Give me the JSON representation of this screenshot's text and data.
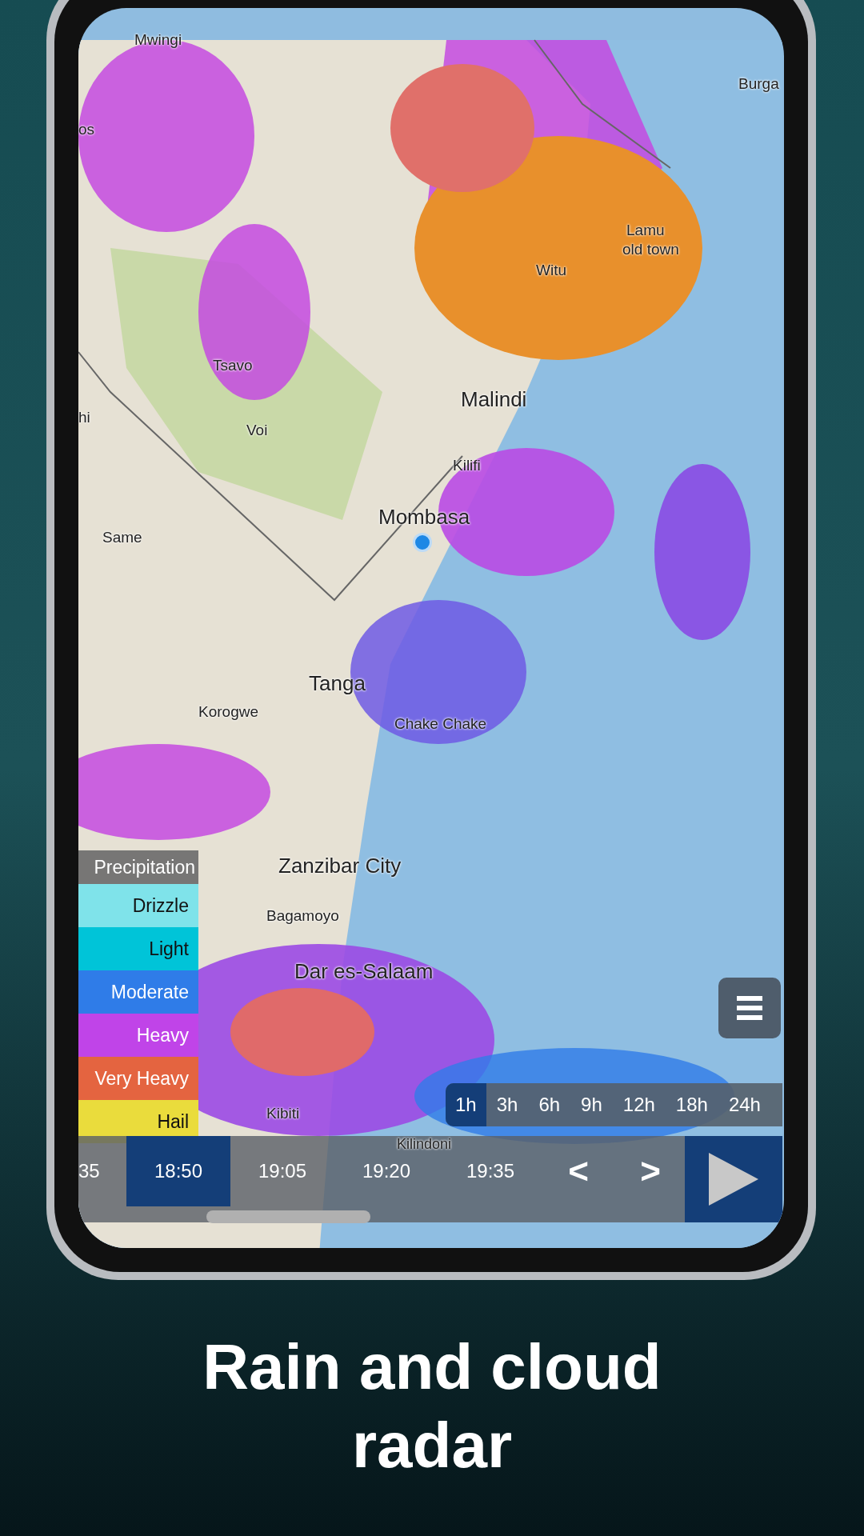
{
  "map": {
    "place_labels": [
      "Mwingi",
      "Burga",
      "os",
      "Lamu",
      "old town",
      "Witu",
      "Tsavo",
      "hi",
      "Malindi",
      "Voi",
      "Kilifi",
      "Same",
      "Mombasa",
      "Tanga",
      "Korogwe",
      "Chake Chake",
      "Zanzibar City",
      "Bagamoyo",
      "Dar es-Salaam",
      "Kibiti",
      "Kilindoni"
    ]
  },
  "legend": {
    "title": "Precipitation",
    "items": [
      {
        "label": "Drizzle",
        "color": "#7fe3ea"
      },
      {
        "label": "Light",
        "color": "#00c4d8"
      },
      {
        "label": "Moderate",
        "color": "#2f7ce8"
      },
      {
        "label": "Heavy",
        "color": "#c044e8"
      },
      {
        "label": "Very Heavy",
        "color": "#e46440"
      },
      {
        "label": "Hail",
        "color": "#eadc3c"
      }
    ]
  },
  "time_ranges": [
    {
      "label": "1h",
      "selected": true
    },
    {
      "label": "3h",
      "selected": false
    },
    {
      "label": "6h",
      "selected": false
    },
    {
      "label": "9h",
      "selected": false
    },
    {
      "label": "12h",
      "selected": false
    },
    {
      "label": "18h",
      "selected": false
    },
    {
      "label": "24h",
      "selected": false
    }
  ],
  "timeline": {
    "times": [
      {
        "label": "35",
        "selected": false
      },
      {
        "label": "18:50",
        "selected": true
      },
      {
        "label": "19:05",
        "selected": false
      },
      {
        "label": "19:20",
        "selected": false
      },
      {
        "label": "19:35",
        "selected": false
      }
    ],
    "prev": "<",
    "next": ">"
  },
  "caption": "Rain and cloud radar"
}
